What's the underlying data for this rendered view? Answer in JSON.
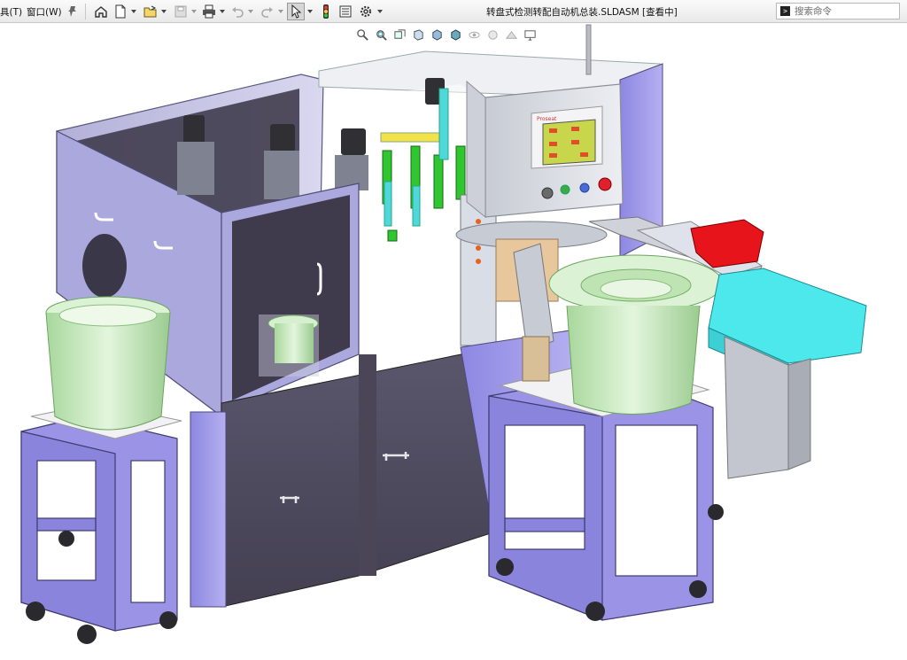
{
  "menu": {
    "tools_label": "具(T)",
    "window_label": "窗口(W)"
  },
  "toolbar": {
    "icons": [
      "pin-icon",
      "home-icon",
      "new-document-icon",
      "open-icon",
      "save-icon",
      "print-icon",
      "undo-icon",
      "redo-icon",
      "select-icon",
      "rebuild-icon",
      "file-properties-icon",
      "options-icon"
    ]
  },
  "title": "转盘式检测转配自动机总装.SLDASM [查看中]",
  "search": {
    "placeholder": "搜索命令",
    "prompt_symbol": ">"
  },
  "hud": {
    "icons": [
      "zoom-to-fit-icon",
      "zoom-area-icon",
      "previous-view-icon",
      "section-view-icon",
      "view-orientation-icon",
      "display-style-icon",
      "hide-show-icon",
      "edit-appearance-icon",
      "apply-scene-icon",
      "view-settings-icon"
    ]
  },
  "model": {
    "control_panel_brand": "Proseat",
    "colors": {
      "frame": "#9b94e6",
      "panel": "#4e4a5e",
      "bowl": "#cfedc5",
      "cyan_bin": "#4de8ec",
      "red_bin": "#e8141c",
      "green_parts": "#2fc62f",
      "screen": "#c7d64a"
    }
  }
}
